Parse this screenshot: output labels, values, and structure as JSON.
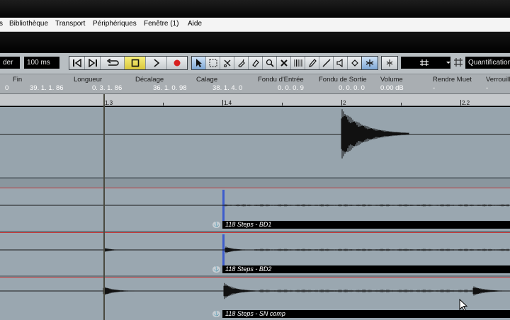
{
  "menu": [
    "s",
    "Bibliothèque",
    "Transport",
    "Périphériques",
    "Fenêtre (1)",
    "Aide"
  ],
  "toolbar": {
    "left_field": "der",
    "preroll_field": "100 ms",
    "grid_label": "Quantification",
    "colors": {
      "play_active": "#e4d24a",
      "record": "#d82020"
    }
  },
  "infoline": {
    "headers": [
      "Fin",
      "Longueur",
      "Décalage",
      "Calage",
      "Fondu d'Entrée",
      "Fondu de Sortie",
      "Volume",
      "Rendre Muet",
      "Verrouill"
    ],
    "values": [
      "0",
      "39. 1. 1. 86",
      "0. 3. 1. 86",
      "36. 1. 0. 98",
      "38. 1. 4.  0",
      "0.  0.  0.    9",
      "0.  0.  0.    0",
      "0.00 dB",
      "-",
      "-"
    ]
  },
  "ruler": {
    "labels": [
      "1.3",
      "1.4",
      "2",
      "2.2"
    ]
  },
  "tracks": [
    {
      "event": "118 Steps - BD1"
    },
    {
      "event": "118 Steps - BD2"
    },
    {
      "event": "118 Steps - SN comp"
    }
  ],
  "icons": [
    "go-to-start-icon",
    "go-to-end-icon",
    "cycle-icon",
    "stop-icon",
    "play-icon",
    "record-icon",
    "arrow-tool-icon",
    "range-tool-icon",
    "split-tool-icon",
    "glue-tool-icon",
    "erase-tool-icon",
    "zoom-tool-icon",
    "mute-tool-icon",
    "time-warp-tool-icon",
    "draw-tool-icon",
    "line-tool-icon",
    "speaker-tool-icon",
    "color-tool-icon",
    "snap-icon",
    "crossfade-icon",
    "grid-icon"
  ]
}
